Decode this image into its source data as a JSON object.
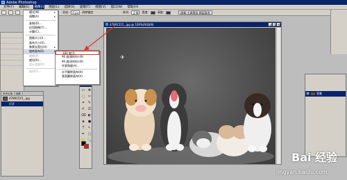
{
  "app": {
    "title": "Adobe Photoshop",
    "menus": [
      "文件(F)",
      "编辑(E)",
      "图像(I)",
      "图层(L)",
      "选择(S)",
      "滤镜(T)",
      "视图(V)",
      "窗口(W)",
      "帮助(H)"
    ],
    "active_menu_index": 2
  },
  "options_bar": {
    "feather_label": "羽化:",
    "feather_value": "0 px",
    "antialias_label": "消除锯齿",
    "style_label": "样式:",
    "style_value": "正常",
    "width_label": "宽度:",
    "height_label": "高度:",
    "palette_well": "画笔  工具预设  图层复合"
  },
  "image_menu": {
    "items": [
      {
        "label": "模式(M)",
        "submenu": true
      },
      {
        "label": "调整(A)",
        "submenu": true
      },
      {
        "sep": true
      },
      {
        "label": "复制(D)..."
      },
      {
        "label": "应用图像(Y)..."
      },
      {
        "label": "计算(C)..."
      },
      {
        "sep": true
      },
      {
        "label": "图像大小(I)..."
      },
      {
        "label": "画布大小(S)..."
      },
      {
        "label": "像素长宽比(X)",
        "submenu": true
      },
      {
        "label": "旋转画布(E)",
        "submenu": true,
        "highlighted": true
      },
      {
        "label": "裁剪(P)",
        "disabled": true
      },
      {
        "label": "裁切(R)..."
      },
      {
        "label": "显示全部(V)",
        "disabled": true
      },
      {
        "sep": true
      },
      {
        "label": "陷印(T)...",
        "disabled": true
      }
    ]
  },
  "rotate_submenu": {
    "items": [
      {
        "label": "180 度(1)",
        "selected": true
      },
      {
        "label": "90 度(顺时针)(9)"
      },
      {
        "label": "90 度(逆时针)(0)"
      },
      {
        "label": "任意角度(A)..."
      },
      {
        "sep": true
      },
      {
        "label": "水平翻转画布(H)"
      },
      {
        "label": "垂直翻转画布(V)"
      }
    ]
  },
  "document": {
    "title": "47891515_.jpg @ 100%(RGB/8)"
  },
  "history_panel": {
    "tabs": [
      "历史记录",
      "动作"
    ],
    "rows": [
      {
        "label": "47891515_.jpg",
        "thumb": true
      },
      {
        "label": "打开",
        "selected": true
      }
    ]
  },
  "layers_panel": {
    "rows": [
      {
        "label": "背景",
        "selected": true
      }
    ]
  },
  "toolbox": {
    "tools": [
      "▭",
      "✥",
      "◌",
      "✂",
      "⌗",
      "✎",
      "✐",
      "⎚",
      "⌫",
      "◐",
      "◈",
      "●",
      "T",
      "↖",
      "✒",
      "▢",
      "✋",
      "🔍"
    ],
    "foreground_color": "#000000",
    "background_color": "#e8141b"
  },
  "watermark": {
    "brand": "Bai 经验",
    "url": "jingyan.baidu.com"
  },
  "colors": {
    "title_bar": "#0a246a",
    "highlight_box": "#d9342b",
    "arrow": "#d9342b"
  }
}
